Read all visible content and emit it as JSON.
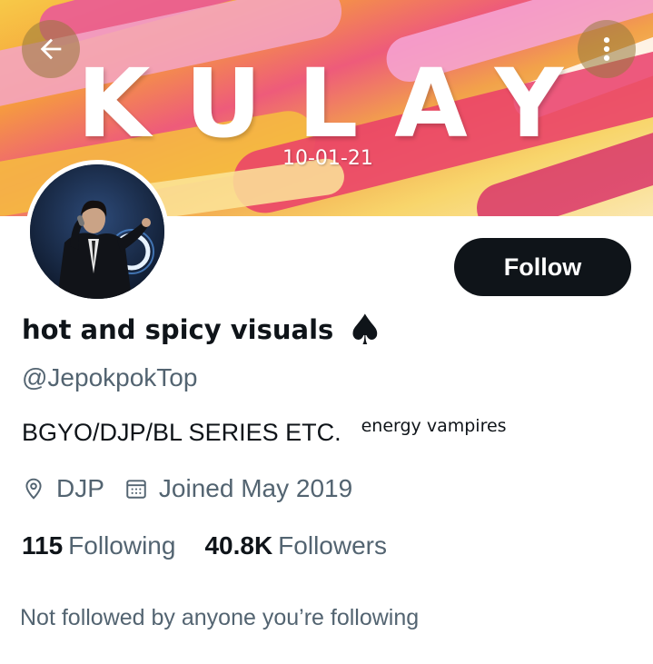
{
  "banner": {
    "title": "KULAY",
    "date": "10-01-21"
  },
  "icons": {
    "back": "arrow-left-icon",
    "more": "more-vertical-icon",
    "location": "location-pin-icon",
    "calendar": "calendar-icon",
    "spade": "spade-icon"
  },
  "follow_label": "Follow",
  "profile": {
    "display_name": "hot and spicy visuals",
    "name_emoji": "♠",
    "handle": "@JepokpokTop",
    "bio": "BGYO/DJP/BL SERIES ETC.",
    "bio_small": "energy vampires",
    "location": "DJP",
    "joined": "Joined May 2019"
  },
  "stats": {
    "following_count": "115",
    "following_label": "Following",
    "followers_count": "40.8K",
    "followers_label": "Followers"
  },
  "not_followed": "Not followed by anyone you’re following",
  "colors": {
    "follow_bg": "#0f1419",
    "muted_text": "#536471"
  }
}
